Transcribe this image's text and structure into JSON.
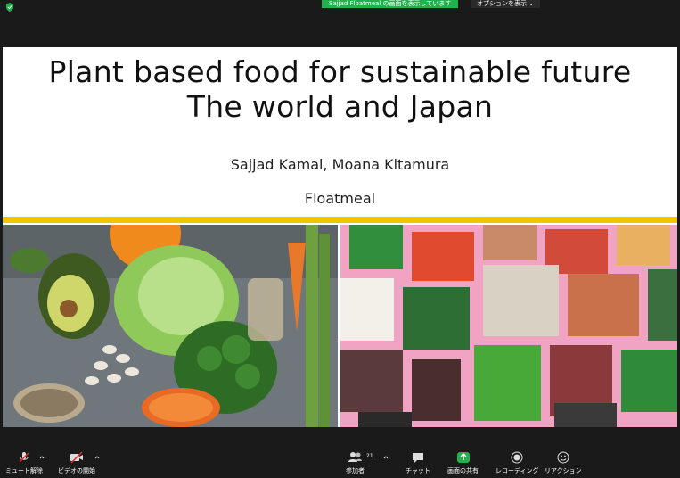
{
  "meeting": {
    "share_banner": "Sajjad  Floatmeal の画面を表示しています",
    "options_label": "オプションを表示 ⌄",
    "participant_count": "21"
  },
  "slide": {
    "title_line1": "Plant based food for sustainable future",
    "title_line2": "The world and Japan",
    "authors": "Sajjad Kamal, Moana Kitamura",
    "organization": "Floatmeal",
    "accent_color": "#f2c300"
  },
  "toolbar": {
    "mute_label": "ミュート解除",
    "video_label": "ビデオの開始",
    "participants_label": "参加者",
    "chat_label": "チャット",
    "share_label": "画面の共有",
    "record_label": "レコーディング",
    "reactions_label": "リアクション",
    "share_color": "#22b14c"
  }
}
